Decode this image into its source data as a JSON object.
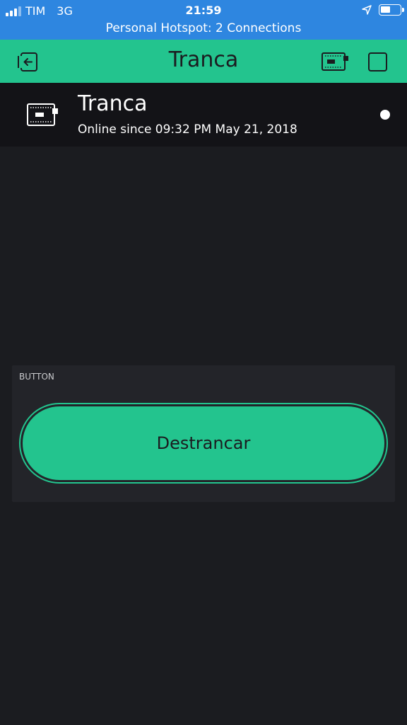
{
  "status_bar": {
    "carrier": "TIM",
    "network": "3G",
    "time": "21:59",
    "battery_level_percent": 50,
    "hotspot_text": "Personal Hotspot: 2 Connections",
    "background_color": "#2e86e0"
  },
  "header": {
    "title": "Tranca",
    "icons": [
      "back-icon",
      "device-icon",
      "stop-icon"
    ],
    "background_color": "#23c48e"
  },
  "device": {
    "name": "Tranca",
    "status": "Online since 09:32 PM May 21, 2018",
    "indicator_color": "#ffffff"
  },
  "widget": {
    "label": "BUTTON",
    "button_label": "Destrancar",
    "accent_color": "#23c48e"
  }
}
